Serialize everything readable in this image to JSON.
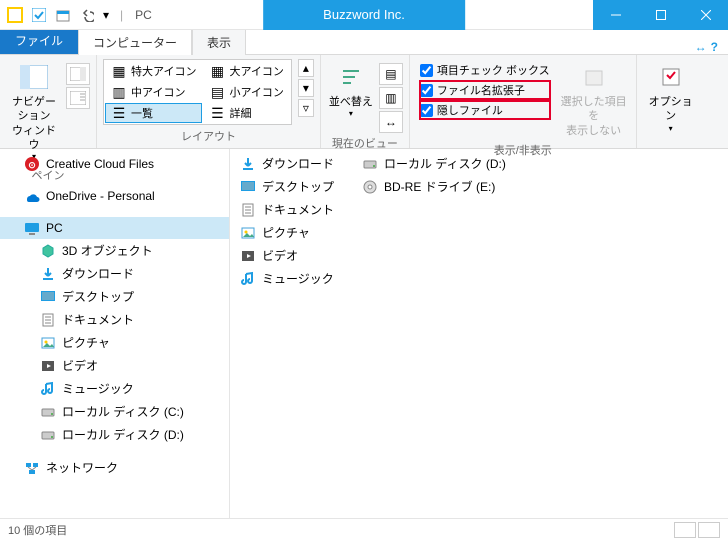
{
  "titlebar": {
    "path": "PC",
    "brand": "Buzzword Inc."
  },
  "tabs": {
    "file": "ファイル",
    "computer": "コンピューター",
    "view": "表示"
  },
  "ribbon": {
    "pane": {
      "nav": "ナビゲーション\nウィンドウ",
      "label": "ペイン"
    },
    "layout": {
      "items": [
        "特大アイコン",
        "大アイコン",
        "中アイコン",
        "小アイコン",
        "一覧",
        "詳細"
      ],
      "label": "レイアウト"
    },
    "currentview": {
      "sort": "並べ替え",
      "label": "現在のビュー"
    },
    "showhide": {
      "chk_itembox": "項目チェック ボックス",
      "chk_ext": "ファイル名拡張子",
      "chk_hidden": "隠しファイル",
      "hide_sel": "選択した項目を\n表示しない",
      "label": "表示/非表示"
    },
    "options": "オプション"
  },
  "tree": [
    {
      "icon": "cc",
      "label": "Creative Cloud Files",
      "lvl": 1
    },
    {
      "icon": "onedrive",
      "label": "OneDrive - Personal",
      "lvl": 1,
      "sep": true
    },
    {
      "icon": "pc",
      "label": "PC",
      "lvl": 1,
      "sel": true,
      "sep": true
    },
    {
      "icon": "3d",
      "label": "3D オブジェクト",
      "lvl": 2
    },
    {
      "icon": "download",
      "label": "ダウンロード",
      "lvl": 2
    },
    {
      "icon": "desktop",
      "label": "デスクトップ",
      "lvl": 2
    },
    {
      "icon": "doc",
      "label": "ドキュメント",
      "lvl": 2
    },
    {
      "icon": "pic",
      "label": "ピクチャ",
      "lvl": 2
    },
    {
      "icon": "video",
      "label": "ビデオ",
      "lvl": 2
    },
    {
      "icon": "music",
      "label": "ミュージック",
      "lvl": 2
    },
    {
      "icon": "disk",
      "label": "ローカル ディスク (C:)",
      "lvl": 2
    },
    {
      "icon": "disk",
      "label": "ローカル ディスク (D:)",
      "lvl": 2
    },
    {
      "icon": "network",
      "label": "ネットワーク",
      "lvl": 1,
      "sep": true
    }
  ],
  "content": {
    "col1": [
      {
        "icon": "download",
        "label": "ダウンロード"
      },
      {
        "icon": "desktop",
        "label": "デスクトップ"
      },
      {
        "icon": "doc",
        "label": "ドキュメント"
      },
      {
        "icon": "pic",
        "label": "ピクチャ"
      },
      {
        "icon": "video",
        "label": "ビデオ"
      },
      {
        "icon": "music",
        "label": "ミュージック"
      }
    ],
    "col2": [
      {
        "icon": "disk",
        "label": "ローカル ディスク (D:)"
      },
      {
        "icon": "bd",
        "label": "BD-RE ドライブ (E:)"
      }
    ]
  },
  "status": {
    "count": "10 個の項目"
  }
}
